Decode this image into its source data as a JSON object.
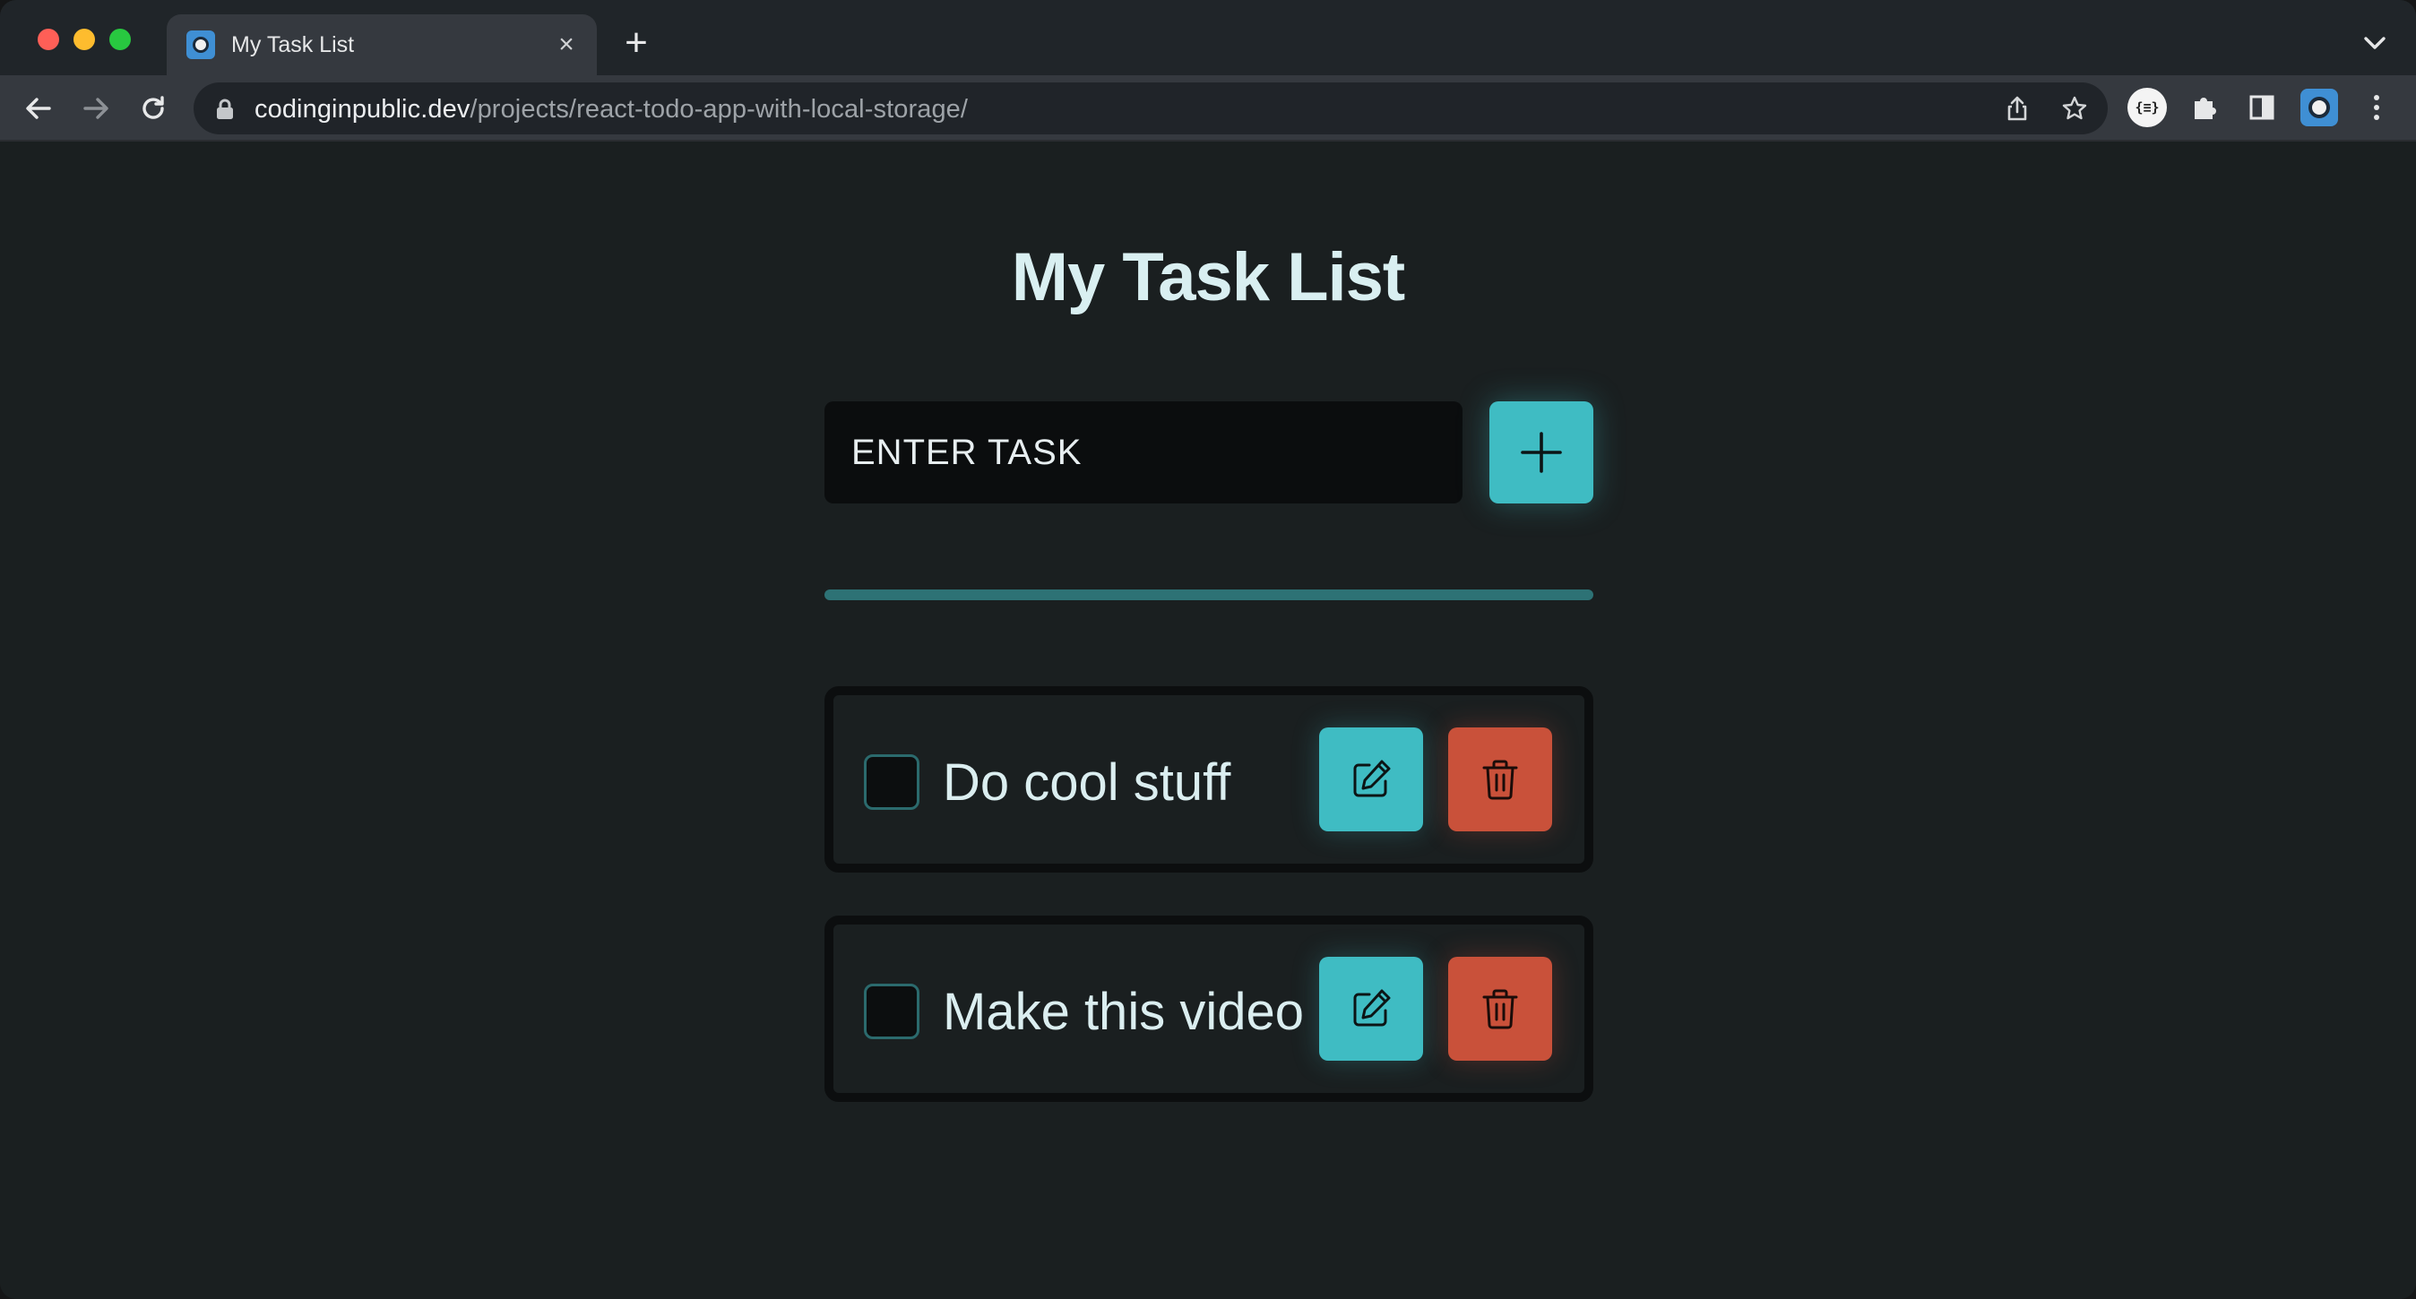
{
  "browser": {
    "tab_title": "My Task List",
    "tab_close": "×",
    "new_tab": "+",
    "url_host": "codinginpublic.dev",
    "url_path": "/projects/react-todo-app-with-local-storage/",
    "json_ext_label": "{≡}"
  },
  "app": {
    "title": "My Task List",
    "input_placeholder": "Enter Task",
    "input_value": "",
    "tasks": [
      {
        "label": "Do cool stuff",
        "checked": false
      },
      {
        "label": "Make this video",
        "checked": false
      }
    ]
  },
  "colors": {
    "accent": "#3fbcc3",
    "danger": "#c9513a",
    "background": "#1a1f20",
    "divider": "#2d7275"
  }
}
